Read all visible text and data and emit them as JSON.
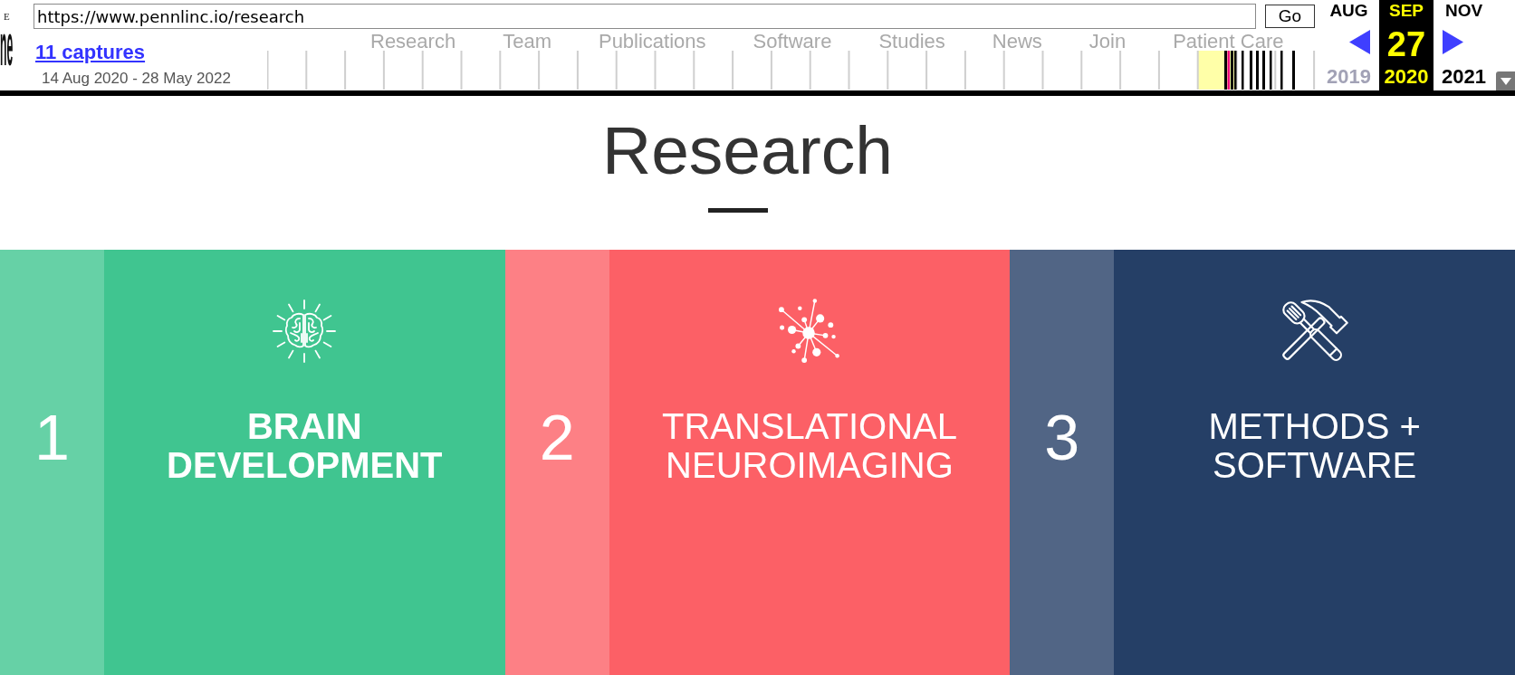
{
  "wayback_toolbar": {
    "logo": {
      "top_fragment": "E",
      "bottom_fragment": "ne"
    },
    "url_field": {
      "value": "https://www.pennlinc.io/research"
    },
    "go_button": "Go",
    "captures_link": "11 captures",
    "capture_range": "14 Aug 2020 - 28 May 2022",
    "faded_page_nav": [
      "Research",
      "Team",
      "Publications",
      "Software",
      "Studies",
      "News",
      "Join",
      "Patient Care"
    ],
    "months": [
      {
        "kind": "previous",
        "month": "AUG",
        "year": "2019",
        "selected": false,
        "dimmed": true
      },
      {
        "kind": "current",
        "month": "SEP",
        "day": "27",
        "year": "2020",
        "selected": true,
        "dimmed": false
      },
      {
        "kind": "next",
        "month": "NOV",
        "year": "2021",
        "selected": false,
        "dimmed": false
      }
    ]
  },
  "page": {
    "title": "Research",
    "areas": [
      {
        "number": "1",
        "kind": "brain",
        "title": "BRAIN DEVELOPMENT",
        "emphasized": true,
        "color": "#40c590"
      },
      {
        "number": "2",
        "kind": "network",
        "title": "TRANSLATIONAL NEUROIMAGING",
        "emphasized": false,
        "color": "#fc6066"
      },
      {
        "number": "3",
        "kind": "tools",
        "title": "METHODS + SOFTWARE",
        "emphasized": false,
        "color": "#253f66"
      }
    ]
  }
}
